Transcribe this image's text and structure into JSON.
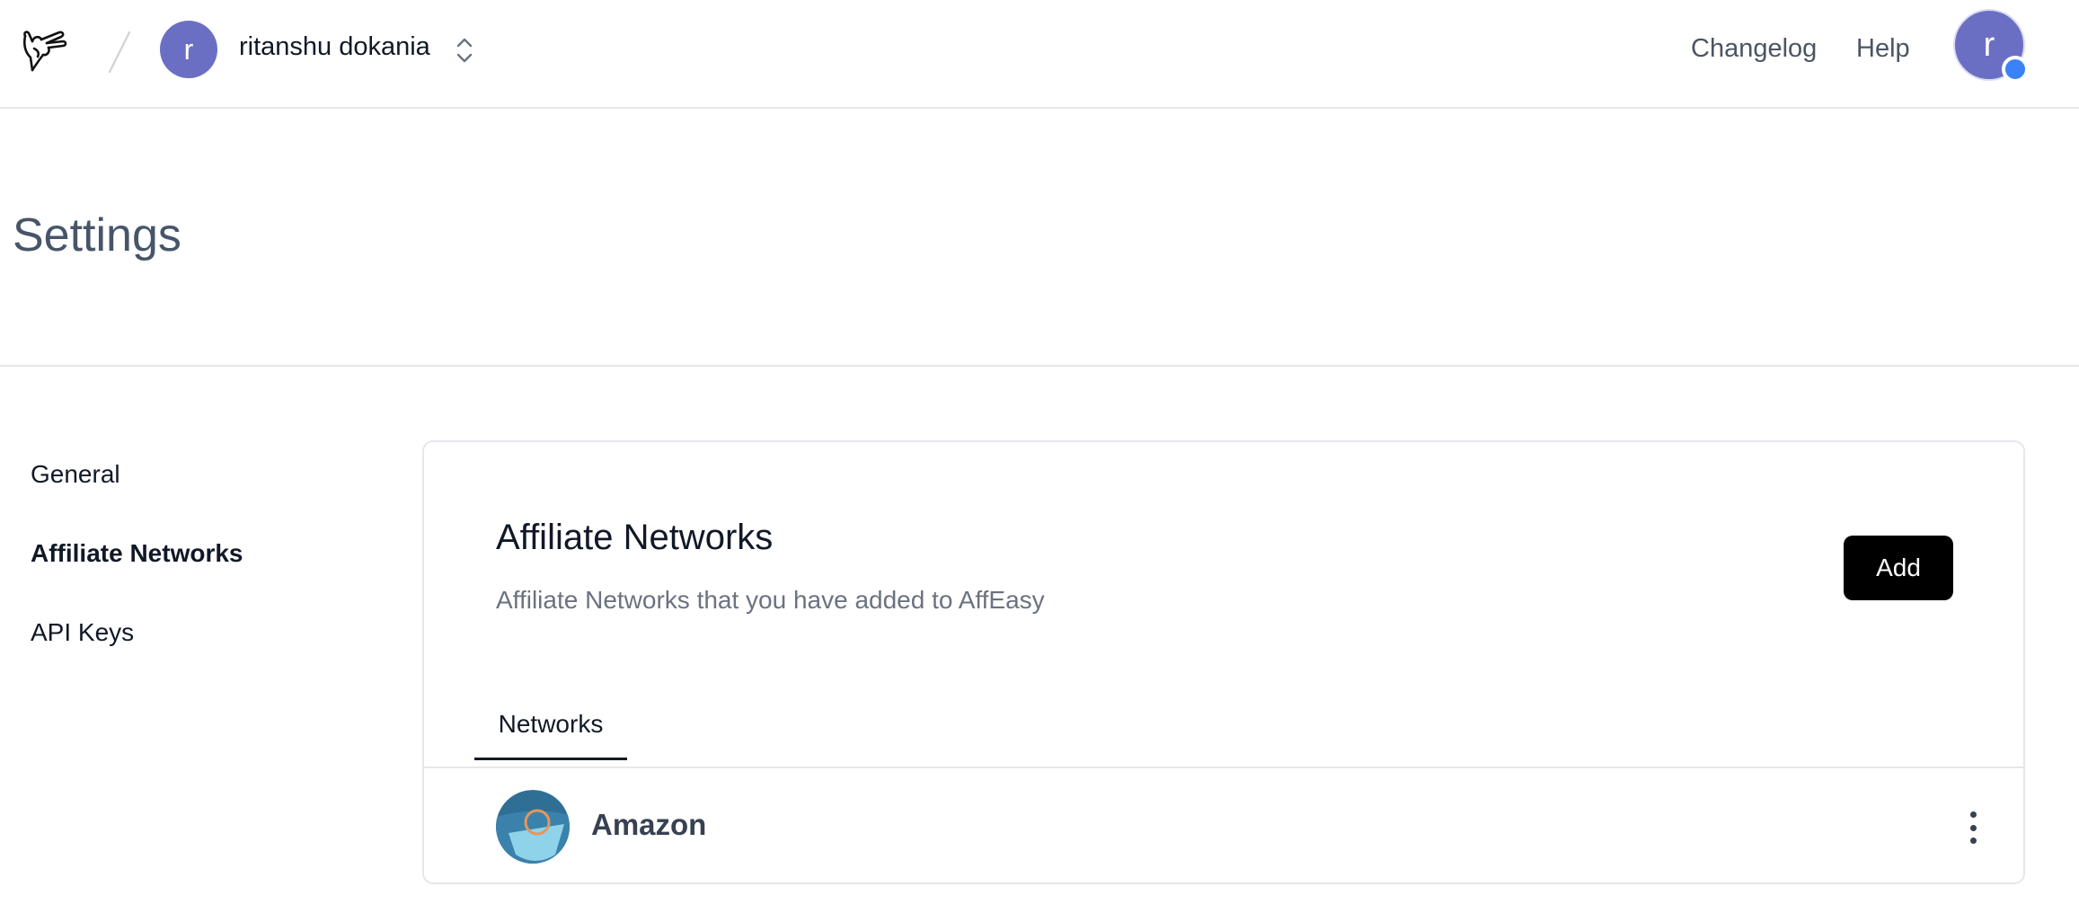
{
  "topbar": {
    "logo_icon": "hand-gesture-logo-icon",
    "workspace": {
      "avatar_letter": "r",
      "name": "ritanshu dokania",
      "switcher_icon": "chevron-up-down-icon"
    },
    "links": {
      "changelog": "Changelog",
      "help": "Help"
    },
    "user": {
      "avatar_letter": "r",
      "status_color": "#3b82f6"
    }
  },
  "page": {
    "title": "Settings"
  },
  "sidebar": {
    "items": [
      {
        "label": "General",
        "active": false
      },
      {
        "label": "Affiliate Networks",
        "active": true
      },
      {
        "label": "API Keys",
        "active": false
      }
    ]
  },
  "card": {
    "title": "Affiliate Networks",
    "subtitle": "Affiliate Networks that you have added to AffEasy",
    "add_label": "Add",
    "tabs": [
      {
        "label": "Networks",
        "active": true
      }
    ],
    "networks": [
      {
        "name": "Amazon",
        "logo_icon": "amazon-network-logo-icon",
        "menu_icon": "kebab-menu-icon"
      }
    ]
  },
  "colors": {
    "avatar": "#6b6fc4",
    "primary_button": "#000000",
    "border": "#e5e7eb"
  }
}
